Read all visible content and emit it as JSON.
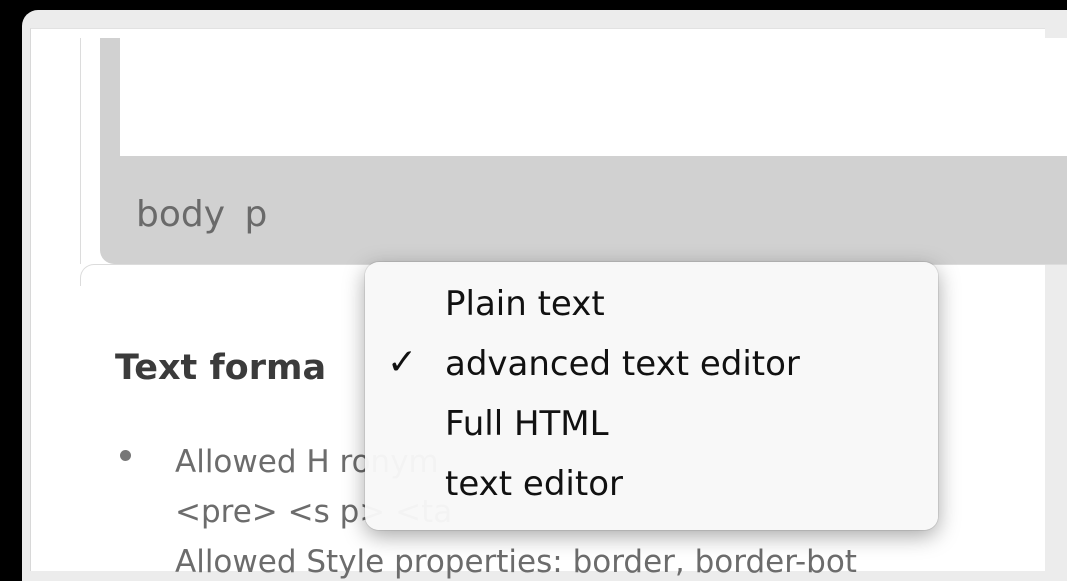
{
  "editor": {
    "path_bar": "body  p"
  },
  "text_format": {
    "title": "Text forma"
  },
  "tips": {
    "line1": "Allowed H                              ronym",
    "line2": "<pre> <s                                      p> <ta",
    "line3": "Allowed Style properties: border, border-bot"
  },
  "format_dropdown": {
    "selected": "advanced text editor",
    "check_glyph": "✓",
    "options": [
      {
        "label": "Plain text"
      },
      {
        "label": "advanced text editor"
      },
      {
        "label": "Full HTML"
      },
      {
        "label": "text editor"
      }
    ]
  }
}
